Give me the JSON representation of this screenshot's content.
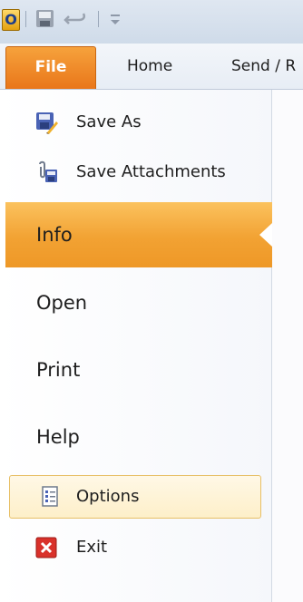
{
  "quick_access": {
    "app_icon_letter": "O",
    "items": [
      "outlook-app-icon",
      "save-icon",
      "undo-icon",
      "customize-arrow-icon"
    ]
  },
  "tabs": {
    "file": "File",
    "home": "Home",
    "send": "Send / R"
  },
  "backstage": {
    "commands": {
      "save_as": "Save As",
      "save_attachments": "Save Attachments"
    },
    "nav": {
      "info": "Info",
      "open": "Open",
      "print": "Print",
      "help": "Help"
    },
    "bottom": {
      "options": "Options",
      "exit": "Exit"
    }
  },
  "colors": {
    "file_tab": "#e9761a",
    "info_highlight": "#f2a233",
    "options_border": "#e7bf66"
  }
}
